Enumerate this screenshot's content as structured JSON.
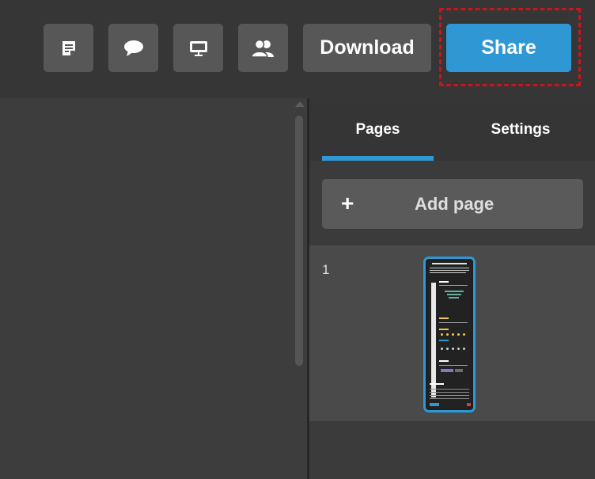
{
  "toolbar": {
    "icons": [
      "notes-icon",
      "comment-icon",
      "present-icon",
      "collaborators-icon"
    ],
    "download_label": "Download",
    "share_label": "Share",
    "accent_color": "#2f98d4",
    "highlight_color": "#c8161c"
  },
  "panel": {
    "tabs": [
      {
        "label": "Pages",
        "active": true
      },
      {
        "label": "Settings",
        "active": false
      }
    ],
    "add_page_label": "Add page",
    "pages": [
      {
        "number": "1",
        "selected": true
      }
    ]
  }
}
